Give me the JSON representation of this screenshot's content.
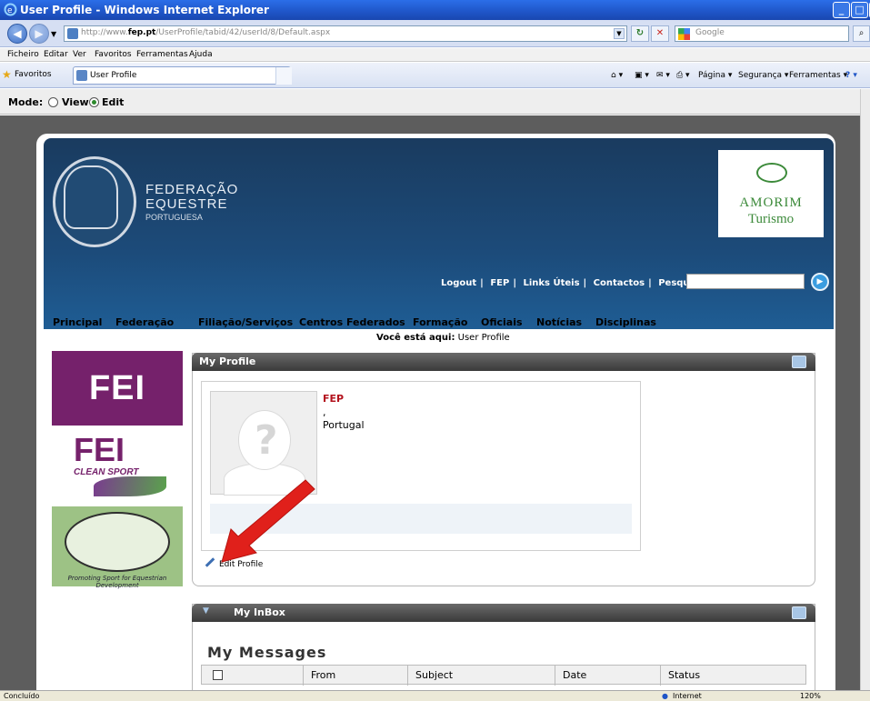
{
  "window": {
    "title": "User Profile - Windows Internet Explorer",
    "min": "_",
    "max": "□",
    "close": "X"
  },
  "addressbar": {
    "url_prefix": "http://www.",
    "url_host": "fep.pt",
    "url_path": "/UserProfile/tabid/42/userId/8/Default.aspx",
    "search_placeholder": "Google"
  },
  "menu": [
    "Ficheiro",
    "Editar",
    "Ver",
    "Favoritos",
    "Ferramentas",
    "Ajuda"
  ],
  "favbar": {
    "favorites_label": "Favoritos",
    "tab_label": "User Profile",
    "commands": [
      "Página ▾",
      "Segurança ▾",
      "Ferramentas ▾"
    ]
  },
  "mode": {
    "label": "Mode:",
    "options": [
      "View",
      "Edit"
    ],
    "selected": "Edit"
  },
  "banner": {
    "org_line1": "FEDERAÇÃO",
    "org_line2": "EQUESTRE",
    "org_line3": "PORTUGUESA",
    "sponsor_line1": "AMORIM",
    "sponsor_line2": "Turismo",
    "top_links": [
      "Logout",
      "FEP",
      "Links Úteis",
      "Contactos"
    ],
    "search_label": "Pesquisar:"
  },
  "nav": [
    "Principal",
    "Federação",
    "Filiação/Serviços",
    "Centros Federados",
    "Formação",
    "Oficiais",
    "Notícias",
    "Disciplinas"
  ],
  "breadcrumb": {
    "label": "Você está aqui:",
    "current": "User Profile"
  },
  "sidebar": {
    "fei": "FEI",
    "clean_sport_logo": "FEI",
    "clean_sport_text": "CLEAN SPORT",
    "world_text": "Promoting Sport for Equestrian Development"
  },
  "profile_panel": {
    "title": "My Profile",
    "name": "FEP",
    "separator": ",",
    "country": "Portugal",
    "edit_link": "Edit Profile"
  },
  "inbox_panel": {
    "title": "My InBox",
    "messages_heading": "My Messages",
    "columns": [
      "From",
      "Subject",
      "Date",
      "Status"
    ]
  },
  "statusbar": {
    "left": "Concluído",
    "zone": "Internet",
    "zoom": "120%"
  },
  "colors": {
    "titlebar": "#1f55c7",
    "banner": "#1c4b7a",
    "fei_purple": "#75216b",
    "accent_red": "#b3121d",
    "arrow": "#e0201b"
  }
}
